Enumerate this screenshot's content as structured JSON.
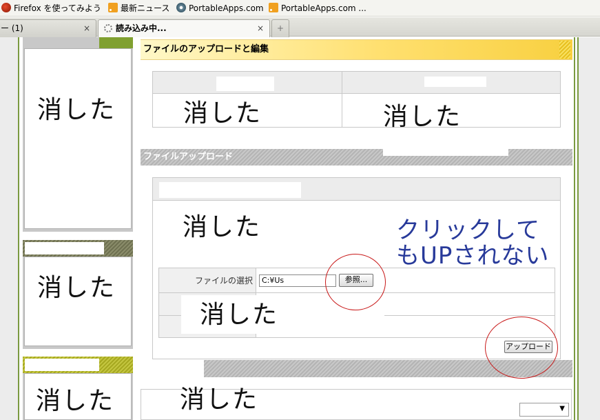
{
  "bookmarks": [
    {
      "label": "Firefox を使ってみよう",
      "icon": "firefox-icon"
    },
    {
      "label": "最新ニュース",
      "icon": "rss-feed-icon"
    },
    {
      "label": "PortableApps.com",
      "icon": "portableapps-icon"
    },
    {
      "label": "PortableApps.com ...",
      "icon": "rss-feed-icon"
    }
  ],
  "tabs": [
    {
      "label": "ー (1)",
      "close": "×"
    },
    {
      "label": "読み込み中...",
      "close": "×"
    }
  ],
  "new_tab": "+",
  "deleted_text": "消した",
  "main": {
    "upload_edit_header": "ファイルのアップロードと編集",
    "file_upload_header": "ファイルアップロード",
    "file_select_label": "ファイルの選択",
    "file_path_value": "C:¥Us",
    "browse_button": "参照...",
    "upload_button": "アップロード"
  },
  "annotation": {
    "line1": "クリックして",
    "line2": "もUPされない",
    "color": "#283a9a",
    "circle_color": "#c81818"
  },
  "colors": {
    "frame_green": "#7a9a40",
    "yellow_header": "#ffe070",
    "gray_header": "#b4b4b4"
  }
}
